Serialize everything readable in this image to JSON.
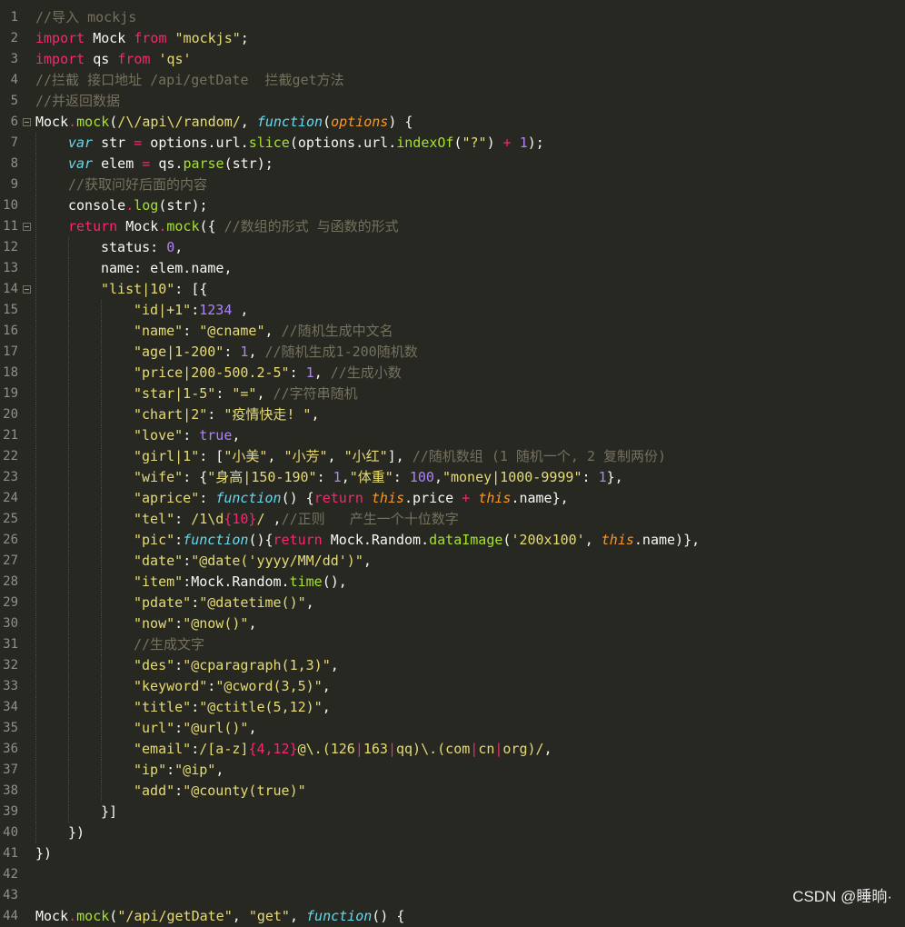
{
  "editor": {
    "theme": {
      "background": "#272822",
      "line_number_color": "#8f908a",
      "plain": "#f8f8f2",
      "keyword": "#f92672",
      "string": "#e6db74",
      "comment": "#75715e",
      "function": "#a6e22e",
      "storage": "#66d9ef",
      "number": "#ae81ff",
      "argument": "#fd971f"
    },
    "lines": [
      {
        "num": "1",
        "fold": false,
        "indent": 0,
        "tokens": [
          [
            "//导入 mockjs",
            "c"
          ]
        ]
      },
      {
        "num": "2",
        "fold": false,
        "indent": 0,
        "tokens": [
          [
            "import",
            "k"
          ],
          [
            " Mock ",
            "p"
          ],
          [
            "from",
            "k"
          ],
          [
            " ",
            "p"
          ],
          [
            "\"mockjs\"",
            "s"
          ],
          [
            ";",
            "p"
          ]
        ]
      },
      {
        "num": "3",
        "fold": false,
        "indent": 0,
        "tokens": [
          [
            "import",
            "k"
          ],
          [
            " qs ",
            "p"
          ],
          [
            "from",
            "k"
          ],
          [
            " ",
            "p"
          ],
          [
            "'qs'",
            "s"
          ]
        ]
      },
      {
        "num": "4",
        "fold": false,
        "indent": 0,
        "tokens": [
          [
            "//拦截 接口地址 /api/getDate  拦截get方法",
            "c"
          ]
        ]
      },
      {
        "num": "5",
        "fold": false,
        "indent": 0,
        "tokens": [
          [
            "//并返回数据",
            "c"
          ]
        ]
      },
      {
        "num": "6",
        "fold": true,
        "indent": 0,
        "tokens": [
          [
            "Mock",
            "p"
          ],
          [
            ".",
            "k"
          ],
          [
            "mock",
            "f"
          ],
          [
            "(",
            "p"
          ],
          [
            "/\\/api\\/random/",
            "s"
          ],
          [
            ", ",
            "p"
          ],
          [
            "function",
            "st"
          ],
          [
            "(",
            "p"
          ],
          [
            "options",
            "ar"
          ],
          [
            ") {",
            "p"
          ]
        ]
      },
      {
        "num": "7",
        "fold": false,
        "indent": 1,
        "tokens": [
          [
            "var",
            "st"
          ],
          [
            " str ",
            "p"
          ],
          [
            "=",
            "k"
          ],
          [
            " options.url.",
            "p"
          ],
          [
            "slice",
            "f"
          ],
          [
            "(options.url.",
            "p"
          ],
          [
            "indexOf",
            "f"
          ],
          [
            "(",
            "p"
          ],
          [
            "\"?\"",
            "s"
          ],
          [
            ") ",
            "p"
          ],
          [
            "+",
            "k"
          ],
          [
            " ",
            "p"
          ],
          [
            "1",
            "n"
          ],
          [
            ");",
            "p"
          ]
        ]
      },
      {
        "num": "8",
        "fold": false,
        "indent": 1,
        "tokens": [
          [
            "var",
            "st"
          ],
          [
            " elem ",
            "p"
          ],
          [
            "=",
            "k"
          ],
          [
            " qs.",
            "p"
          ],
          [
            "parse",
            "f"
          ],
          [
            "(str);",
            "p"
          ]
        ]
      },
      {
        "num": "9",
        "fold": false,
        "indent": 1,
        "tokens": [
          [
            "//获取问好后面的内容",
            "c"
          ]
        ]
      },
      {
        "num": "10",
        "fold": false,
        "indent": 1,
        "tokens": [
          [
            "console",
            "p"
          ],
          [
            ".",
            "k"
          ],
          [
            "log",
            "f"
          ],
          [
            "(str);",
            "p"
          ]
        ]
      },
      {
        "num": "11",
        "fold": true,
        "indent": 1,
        "tokens": [
          [
            "return",
            "k"
          ],
          [
            " Mock",
            "p"
          ],
          [
            ".",
            "k"
          ],
          [
            "mock",
            "f"
          ],
          [
            "({ ",
            "p"
          ],
          [
            "//数组的形式 与函数的形式",
            "c"
          ]
        ]
      },
      {
        "num": "12",
        "fold": false,
        "indent": 2,
        "tokens": [
          [
            "status: ",
            "p"
          ],
          [
            "0",
            "n"
          ],
          [
            ",",
            "p"
          ]
        ]
      },
      {
        "num": "13",
        "fold": false,
        "indent": 2,
        "tokens": [
          [
            "name: elem.name,",
            "p"
          ]
        ]
      },
      {
        "num": "14",
        "fold": true,
        "indent": 2,
        "tokens": [
          [
            "\"list|10\"",
            "s"
          ],
          [
            ": [{",
            "p"
          ]
        ]
      },
      {
        "num": "15",
        "fold": false,
        "indent": 3,
        "tokens": [
          [
            "\"id|+1\"",
            "s"
          ],
          [
            ":",
            "p"
          ],
          [
            "1234",
            "n"
          ],
          [
            " ,",
            "p"
          ]
        ]
      },
      {
        "num": "16",
        "fold": false,
        "indent": 3,
        "tokens": [
          [
            "\"name\"",
            "s"
          ],
          [
            ": ",
            "p"
          ],
          [
            "\"@cname\"",
            "s"
          ],
          [
            ", ",
            "p"
          ],
          [
            "//随机生成中文名",
            "c"
          ]
        ]
      },
      {
        "num": "17",
        "fold": false,
        "indent": 3,
        "tokens": [
          [
            "\"age|1-200\"",
            "s"
          ],
          [
            ": ",
            "p"
          ],
          [
            "1",
            "n"
          ],
          [
            ", ",
            "p"
          ],
          [
            "//随机生成1-200随机数",
            "c"
          ]
        ]
      },
      {
        "num": "18",
        "fold": false,
        "indent": 3,
        "tokens": [
          [
            "\"price|200-500.2-5\"",
            "s"
          ],
          [
            ": ",
            "p"
          ],
          [
            "1",
            "n"
          ],
          [
            ", ",
            "p"
          ],
          [
            "//生成小数",
            "c"
          ]
        ]
      },
      {
        "num": "19",
        "fold": false,
        "indent": 3,
        "tokens": [
          [
            "\"star|1-5\"",
            "s"
          ],
          [
            ": ",
            "p"
          ],
          [
            "\"=\"",
            "s"
          ],
          [
            ", ",
            "p"
          ],
          [
            "//字符串随机",
            "c"
          ]
        ]
      },
      {
        "num": "20",
        "fold": false,
        "indent": 3,
        "tokens": [
          [
            "\"chart|2\"",
            "s"
          ],
          [
            ": ",
            "p"
          ],
          [
            "\"疫情快走! \"",
            "s"
          ],
          [
            ",",
            "p"
          ]
        ]
      },
      {
        "num": "21",
        "fold": false,
        "indent": 3,
        "tokens": [
          [
            "\"love\"",
            "s"
          ],
          [
            ": ",
            "p"
          ],
          [
            "true",
            "n"
          ],
          [
            ",",
            "p"
          ]
        ]
      },
      {
        "num": "22",
        "fold": false,
        "indent": 3,
        "tokens": [
          [
            "\"girl|1\"",
            "s"
          ],
          [
            ": [",
            "p"
          ],
          [
            "\"小美\"",
            "s"
          ],
          [
            ", ",
            "p"
          ],
          [
            "\"小芳\"",
            "s"
          ],
          [
            ", ",
            "p"
          ],
          [
            "\"小红\"",
            "s"
          ],
          [
            "], ",
            "p"
          ],
          [
            "//随机数组 (1 随机一个, 2 复制两份)",
            "c"
          ]
        ]
      },
      {
        "num": "23",
        "fold": false,
        "indent": 3,
        "tokens": [
          [
            "\"wife\"",
            "s"
          ],
          [
            ": {",
            "p"
          ],
          [
            "\"身高|150-190\"",
            "s"
          ],
          [
            ": ",
            "p"
          ],
          [
            "1",
            "n"
          ],
          [
            ",",
            "p"
          ],
          [
            "\"体重\"",
            "s"
          ],
          [
            ": ",
            "p"
          ],
          [
            "100",
            "n"
          ],
          [
            ",",
            "p"
          ],
          [
            "\"money|1000-9999\"",
            "s"
          ],
          [
            ": ",
            "p"
          ],
          [
            "1",
            "n"
          ],
          [
            "},",
            "p"
          ]
        ]
      },
      {
        "num": "24",
        "fold": false,
        "indent": 3,
        "tokens": [
          [
            "\"aprice\"",
            "s"
          ],
          [
            ": ",
            "p"
          ],
          [
            "function",
            "st"
          ],
          [
            "() {",
            "p"
          ],
          [
            "return",
            "k"
          ],
          [
            " ",
            "p"
          ],
          [
            "this",
            "ar"
          ],
          [
            ".price ",
            "p"
          ],
          [
            "+",
            "k"
          ],
          [
            " ",
            "p"
          ],
          [
            "this",
            "ar"
          ],
          [
            ".name},",
            "p"
          ]
        ]
      },
      {
        "num": "25",
        "fold": false,
        "indent": 3,
        "tokens": [
          [
            "\"tel\"",
            "s"
          ],
          [
            ": ",
            "p"
          ],
          [
            "/1\\d",
            "s"
          ],
          [
            "{10}",
            "k"
          ],
          [
            "/",
            "s"
          ],
          [
            " ,",
            "p"
          ],
          [
            "//正则   产生一个十位数字",
            "c"
          ]
        ]
      },
      {
        "num": "26",
        "fold": false,
        "indent": 3,
        "tokens": [
          [
            "\"pic\"",
            "s"
          ],
          [
            ":",
            "p"
          ],
          [
            "function",
            "st"
          ],
          [
            "(){",
            "p"
          ],
          [
            "return",
            "k"
          ],
          [
            " Mock.Random.",
            "p"
          ],
          [
            "dataImage",
            "f"
          ],
          [
            "(",
            "p"
          ],
          [
            "'200x100'",
            "s"
          ],
          [
            ", ",
            "p"
          ],
          [
            "this",
            "ar"
          ],
          [
            ".name)},",
            "p"
          ]
        ]
      },
      {
        "num": "27",
        "fold": false,
        "indent": 3,
        "tokens": [
          [
            "\"date\"",
            "s"
          ],
          [
            ":",
            "p"
          ],
          [
            "\"@date('yyyy/MM/dd')\"",
            "s"
          ],
          [
            ",",
            "p"
          ]
        ]
      },
      {
        "num": "28",
        "fold": false,
        "indent": 3,
        "tokens": [
          [
            "\"item\"",
            "s"
          ],
          [
            ":Mock.Random.",
            "p"
          ],
          [
            "time",
            "f"
          ],
          [
            "(),",
            "p"
          ]
        ]
      },
      {
        "num": "29",
        "fold": false,
        "indent": 3,
        "tokens": [
          [
            "\"pdate\"",
            "s"
          ],
          [
            ":",
            "p"
          ],
          [
            "\"@datetime()\"",
            "s"
          ],
          [
            ",",
            "p"
          ]
        ]
      },
      {
        "num": "30",
        "fold": false,
        "indent": 3,
        "tokens": [
          [
            "\"now\"",
            "s"
          ],
          [
            ":",
            "p"
          ],
          [
            "\"@now()\"",
            "s"
          ],
          [
            ",",
            "p"
          ]
        ]
      },
      {
        "num": "31",
        "fold": false,
        "indent": 3,
        "tokens": [
          [
            "//生成文字",
            "c"
          ]
        ]
      },
      {
        "num": "32",
        "fold": false,
        "indent": 3,
        "tokens": [
          [
            "\"des\"",
            "s"
          ],
          [
            ":",
            "p"
          ],
          [
            "\"@cparagraph(1,3)\"",
            "s"
          ],
          [
            ",",
            "p"
          ]
        ]
      },
      {
        "num": "33",
        "fold": false,
        "indent": 3,
        "tokens": [
          [
            "\"keyword\"",
            "s"
          ],
          [
            ":",
            "p"
          ],
          [
            "\"@cword(3,5)\"",
            "s"
          ],
          [
            ",",
            "p"
          ]
        ]
      },
      {
        "num": "34",
        "fold": false,
        "indent": 3,
        "tokens": [
          [
            "\"title\"",
            "s"
          ],
          [
            ":",
            "p"
          ],
          [
            "\"@ctitle(5,12)\"",
            "s"
          ],
          [
            ",",
            "p"
          ]
        ]
      },
      {
        "num": "35",
        "fold": false,
        "indent": 3,
        "tokens": [
          [
            "\"url\"",
            "s"
          ],
          [
            ":",
            "p"
          ],
          [
            "\"@url()\"",
            "s"
          ],
          [
            ",",
            "p"
          ]
        ]
      },
      {
        "num": "36",
        "fold": false,
        "indent": 3,
        "tokens": [
          [
            "\"email\"",
            "s"
          ],
          [
            ":",
            "p"
          ],
          [
            "/[a-z]",
            "s"
          ],
          [
            "{4,12}",
            "k"
          ],
          [
            "@\\.(126",
            "s"
          ],
          [
            "|",
            "k"
          ],
          [
            "163",
            "s"
          ],
          [
            "|",
            "k"
          ],
          [
            "qq)\\.(com",
            "s"
          ],
          [
            "|",
            "k"
          ],
          [
            "cn",
            "s"
          ],
          [
            "|",
            "k"
          ],
          [
            "org)/",
            "s"
          ],
          [
            ",",
            "p"
          ]
        ]
      },
      {
        "num": "37",
        "fold": false,
        "indent": 3,
        "tokens": [
          [
            "\"ip\"",
            "s"
          ],
          [
            ":",
            "p"
          ],
          [
            "\"@ip\"",
            "s"
          ],
          [
            ",",
            "p"
          ]
        ]
      },
      {
        "num": "38",
        "fold": false,
        "indent": 3,
        "tokens": [
          [
            "\"add\"",
            "s"
          ],
          [
            ":",
            "p"
          ],
          [
            "\"@county(true)\"",
            "s"
          ]
        ]
      },
      {
        "num": "39",
        "fold": false,
        "indent": 2,
        "tokens": [
          [
            "}]",
            "p"
          ]
        ]
      },
      {
        "num": "40",
        "fold": false,
        "indent": 1,
        "tokens": [
          [
            "})",
            "p"
          ]
        ]
      },
      {
        "num": "41",
        "fold": false,
        "indent": 0,
        "tokens": [
          [
            "})",
            "p"
          ]
        ]
      },
      {
        "num": "42",
        "fold": false,
        "indent": 0,
        "tokens": []
      },
      {
        "num": "43",
        "fold": false,
        "indent": 0,
        "tokens": []
      },
      {
        "num": "44",
        "fold": false,
        "indent": 0,
        "tokens": [
          [
            "Mock",
            "p"
          ],
          [
            ".",
            "k"
          ],
          [
            "mock",
            "f"
          ],
          [
            "(",
            "p"
          ],
          [
            "\"/api/getDate\"",
            "s"
          ],
          [
            ", ",
            "p"
          ],
          [
            "\"get\"",
            "s"
          ],
          [
            ", ",
            "p"
          ],
          [
            "function",
            "st"
          ],
          [
            "() {",
            "p"
          ]
        ]
      }
    ]
  },
  "watermark": "CSDN @睡晌·"
}
